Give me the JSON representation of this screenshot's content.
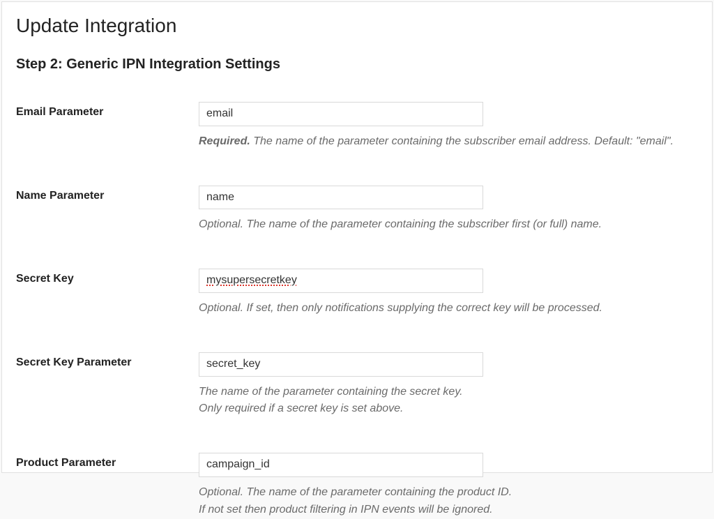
{
  "page_title": "Update Integration",
  "step_heading": "Step 2: Generic IPN Integration Settings",
  "fields": {
    "email_parameter": {
      "label": "Email Parameter",
      "value": "email",
      "description_required": "Required.",
      "description_rest": " The name of the parameter containing the subscriber email address. Default: \"email\"."
    },
    "name_parameter": {
      "label": "Name Parameter",
      "value": "name",
      "description": "Optional. The name of the parameter containing the subscriber first (or full) name."
    },
    "secret_key": {
      "label": "Secret Key",
      "value": "mysupersecretkey",
      "description": "Optional. If set, then only notifications supplying the correct key will be processed."
    },
    "secret_key_parameter": {
      "label": "Secret Key Parameter",
      "value": "secret_key",
      "description_line1": "The name of the parameter containing the secret key.",
      "description_line2": "Only required if a secret key is set above."
    },
    "product_parameter": {
      "label": "Product Parameter",
      "value": "campaign_id",
      "description_line1": "Optional. The name of the parameter containing the product ID.",
      "description_line2": "If not set then product filtering in IPN events will be ignored."
    }
  }
}
